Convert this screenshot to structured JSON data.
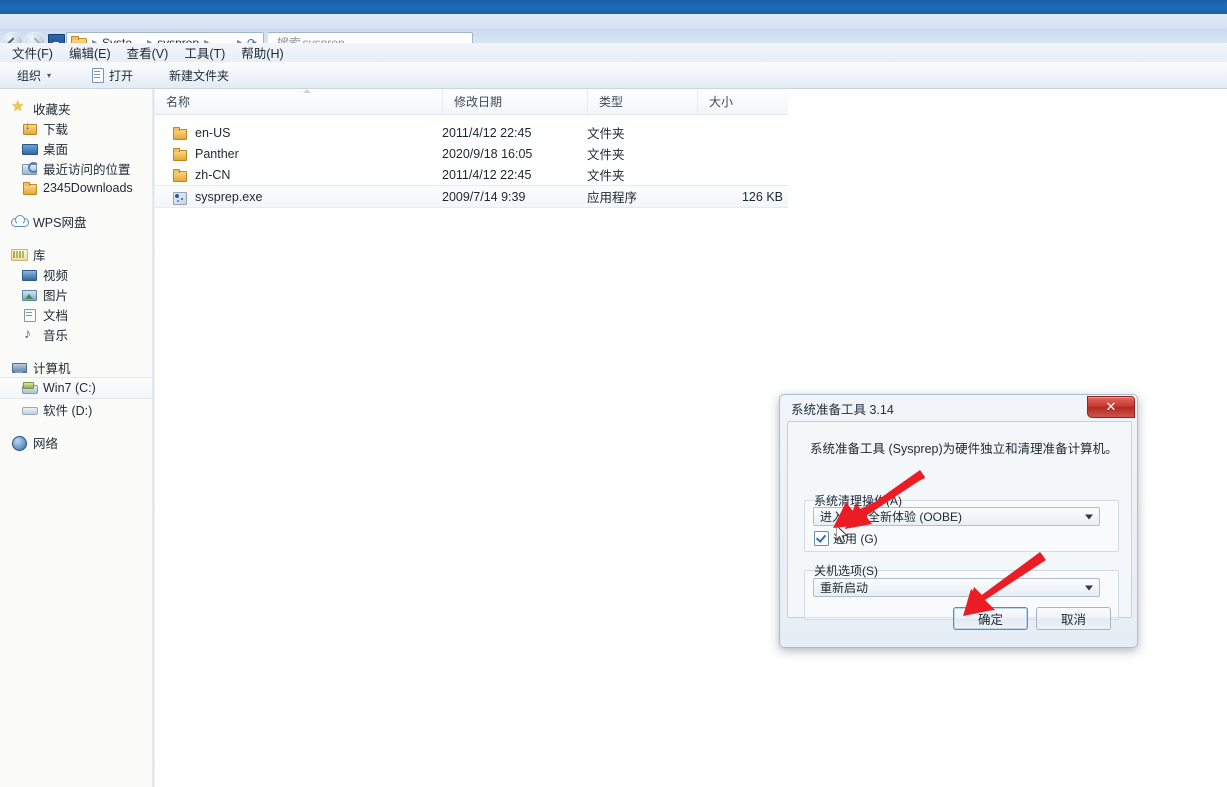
{
  "window": {
    "address": {
      "crumbs": [
        "Syste...",
        "sysprep"
      ],
      "separator": "▸"
    },
    "search": {
      "placeholder": "搜索 sysprep"
    },
    "menubar": [
      "文件(F)",
      "编辑(E)",
      "查看(V)",
      "工具(T)",
      "帮助(H)"
    ],
    "commandbar": {
      "organize": "组织",
      "organize_caret": "▾",
      "open": "打开",
      "new_folder": "新建文件夹"
    }
  },
  "sidebar": {
    "groups": [
      {
        "header": {
          "label": "收藏夹",
          "icon": "star-icon"
        },
        "items": [
          {
            "label": "下载",
            "icon": "download-folder-icon"
          },
          {
            "label": "桌面",
            "icon": "desktop-icon"
          },
          {
            "label": "最近访问的位置",
            "icon": "recent-places-icon"
          },
          {
            "label": "2345Downloads",
            "icon": "folder-icon"
          }
        ]
      },
      {
        "header": {
          "label": "WPS网盘",
          "icon": "cloud-icon"
        },
        "items": []
      },
      {
        "header": {
          "label": "库",
          "icon": "library-icon"
        },
        "items": [
          {
            "label": "视频",
            "icon": "video-icon"
          },
          {
            "label": "图片",
            "icon": "picture-icon"
          },
          {
            "label": "文档",
            "icon": "document-icon"
          },
          {
            "label": "音乐",
            "icon": "music-icon"
          }
        ]
      },
      {
        "header": {
          "label": "计算机",
          "icon": "computer-icon"
        },
        "items": [
          {
            "label": "Win7 (C:)",
            "icon": "hard-drive-icon",
            "selected": true
          },
          {
            "label": "软件 (D:)",
            "icon": "hard-drive-icon"
          }
        ]
      },
      {
        "header": {
          "label": "网络",
          "icon": "network-icon"
        },
        "items": []
      }
    ]
  },
  "filelist": {
    "columns": [
      "名称",
      "修改日期",
      "类型",
      "大小"
    ],
    "rows": [
      {
        "name": "en-US",
        "date": "2011/4/12 22:45",
        "type": "文件夹",
        "size": "",
        "icon": "folder-icon"
      },
      {
        "name": "Panther",
        "date": "2020/9/18 16:05",
        "type": "文件夹",
        "size": "",
        "icon": "folder-icon"
      },
      {
        "name": "zh-CN",
        "date": "2011/4/12 22:45",
        "type": "文件夹",
        "size": "",
        "icon": "folder-icon"
      },
      {
        "name": "sysprep.exe",
        "date": "2009/7/14 9:39",
        "type": "应用程序",
        "size": "126 KB",
        "icon": "exe-icon"
      }
    ]
  },
  "dialog": {
    "title": "系统准备工具 3.14",
    "close_label": "✕",
    "description": "系统准备工具 (Sysprep)为硬件独立和清理准备计算机。",
    "cleanup_group_label": "系统清理操作(A)",
    "cleanup_value": "进入系统全新体验 (OOBE)",
    "generalize_label": "通用 (G)",
    "generalize_checked": true,
    "shutdown_group_label": "关机选项(S)",
    "shutdown_value": "重新启动",
    "ok_label": "确定",
    "cancel_label": "取消"
  },
  "annotations": {
    "arrow_color": "#ec1c24",
    "arrow_targets": [
      "generalize-checkbox",
      "ok-button"
    ]
  }
}
